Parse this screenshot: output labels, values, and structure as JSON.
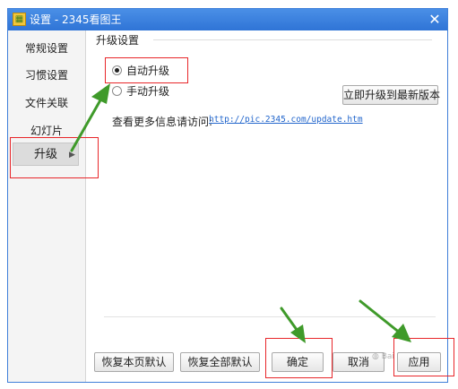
{
  "window": {
    "title": "设置 - 2345看图王",
    "close_glyph": "✕"
  },
  "sidebar": {
    "items": [
      {
        "label": "常规设置"
      },
      {
        "label": "习惯设置"
      },
      {
        "label": "文件关联"
      },
      {
        "label": "幻灯片"
      },
      {
        "label": "升级",
        "selected": true
      }
    ]
  },
  "upgrade": {
    "section_title": "升级设置",
    "options": [
      {
        "label": "自动升级",
        "checked": true
      },
      {
        "label": "手动升级",
        "checked": false
      }
    ],
    "upgrade_now_label": "立即升级到最新版本",
    "info_label": "查看更多信息请访问:",
    "info_link": "http://pic.2345.com/update.htm"
  },
  "footer": {
    "restore_page_label": "恢复本页默认",
    "restore_all_label": "恢复全部默认",
    "ok_label": "确定",
    "cancel_label": "取消",
    "apply_label": "应用"
  },
  "annotations": {
    "highlight_color": "#e8262a",
    "arrow_color": "#3f9a2a"
  }
}
